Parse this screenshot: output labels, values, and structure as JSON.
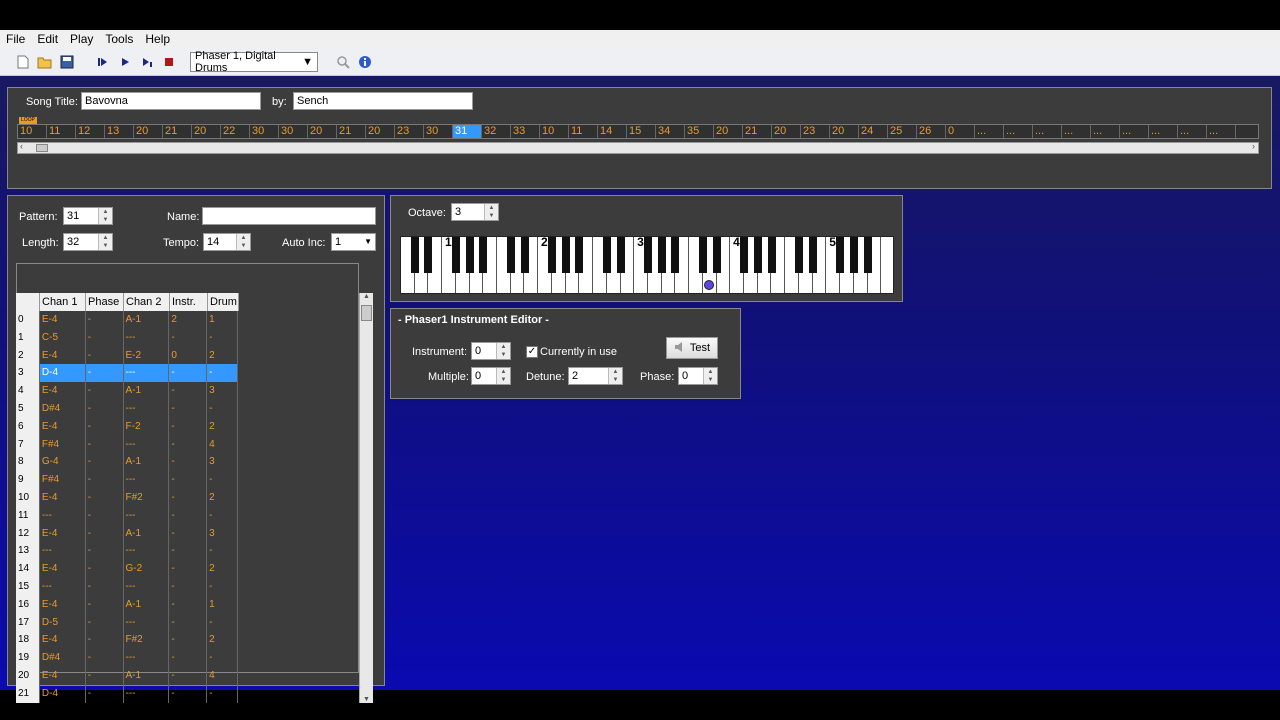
{
  "menu": [
    "File",
    "Edit",
    "Play",
    "Tools",
    "Help"
  ],
  "toolbar": {
    "engine_value": "Phaser 1, Digital Drums"
  },
  "song": {
    "title_label": "Song Title:",
    "title_value": "Bavovna",
    "by_label": "by:",
    "by_value": "Sench",
    "loop_label": "LOOP"
  },
  "order": {
    "cells": [
      "10",
      "11",
      "12",
      "13",
      "20",
      "21",
      "20",
      "22",
      "30",
      "30",
      "20",
      "21",
      "20",
      "23",
      "30",
      "31",
      "32",
      "33",
      "10",
      "11",
      "14",
      "15",
      "34",
      "35",
      "20",
      "21",
      "20",
      "23",
      "20",
      "24",
      "25",
      "26",
      "0",
      "...",
      "...",
      "...",
      "...",
      "...",
      "...",
      "...",
      "...",
      "..."
    ],
    "selected_index": 15
  },
  "pattern": {
    "pattern_label": "Pattern:",
    "pattern_value": "31",
    "name_label": "Name:",
    "name_value": "",
    "length_label": "Length:",
    "length_value": "32",
    "tempo_label": "Tempo:",
    "tempo_value": "14",
    "autoinc_label": "Auto Inc:",
    "autoinc_value": "1",
    "columns": [
      "Chan 1",
      "Phase",
      "Chan 2",
      "Instr.",
      "Drum"
    ],
    "selected_row": 3,
    "rows": [
      [
        "0",
        "E-4",
        "-",
        "A-1",
        "2",
        "1"
      ],
      [
        "1",
        "C-5",
        "-",
        "---",
        "-",
        "-"
      ],
      [
        "2",
        "E-4",
        "-",
        "E-2",
        "0",
        "2"
      ],
      [
        "3",
        "D-4",
        "-",
        "---",
        "-",
        "-"
      ],
      [
        "4",
        "E-4",
        "-",
        "A-1",
        "-",
        "3"
      ],
      [
        "5",
        "D#4",
        "-",
        "---",
        "-",
        "-"
      ],
      [
        "6",
        "E-4",
        "-",
        "F-2",
        "-",
        "2"
      ],
      [
        "7",
        "F#4",
        "-",
        "---",
        "-",
        "4"
      ],
      [
        "8",
        "G-4",
        "-",
        "A-1",
        "-",
        "3"
      ],
      [
        "9",
        "F#4",
        "-",
        "---",
        "-",
        "-"
      ],
      [
        "10",
        "E-4",
        "-",
        "F#2",
        "-",
        "2"
      ],
      [
        "11",
        "---",
        "-",
        "---",
        "-",
        "-"
      ],
      [
        "12",
        "E-4",
        "-",
        "A-1",
        "-",
        "3"
      ],
      [
        "13",
        "---",
        "-",
        "---",
        "-",
        "-"
      ],
      [
        "14",
        "E-4",
        "-",
        "G-2",
        "-",
        "2"
      ],
      [
        "15",
        "---",
        "-",
        "---",
        "-",
        "-"
      ],
      [
        "16",
        "E-4",
        "-",
        "A-1",
        "-",
        "1"
      ],
      [
        "17",
        "D-5",
        "-",
        "---",
        "-",
        "-"
      ],
      [
        "18",
        "E-4",
        "-",
        "F#2",
        "-",
        "2"
      ],
      [
        "19",
        "D#4",
        "-",
        "---",
        "-",
        "-"
      ],
      [
        "20",
        "E-4",
        "-",
        "A-1",
        "-",
        "4"
      ],
      [
        "21",
        "D-4",
        "-",
        "---",
        "-",
        "-"
      ]
    ]
  },
  "keyboard": {
    "octave_label": "Octave:",
    "octave_value": "3",
    "octave_numbers": [
      "1",
      "2",
      "3",
      "4",
      "5"
    ]
  },
  "instrument": {
    "title": "- Phaser1 Instrument Editor -",
    "instrument_label": "Instrument:",
    "instrument_value": "0",
    "in_use_label": "Currently in use",
    "test_label": "Test",
    "multiple_label": "Multiple:",
    "multiple_value": "0",
    "detune_label": "Detune:",
    "detune_value": "2",
    "phase_label": "Phase:",
    "phase_value": "0"
  },
  "colors": {
    "note_text": "#e89b2b",
    "selection": "#3399ff",
    "panel_bg": "#3c3c3c"
  }
}
